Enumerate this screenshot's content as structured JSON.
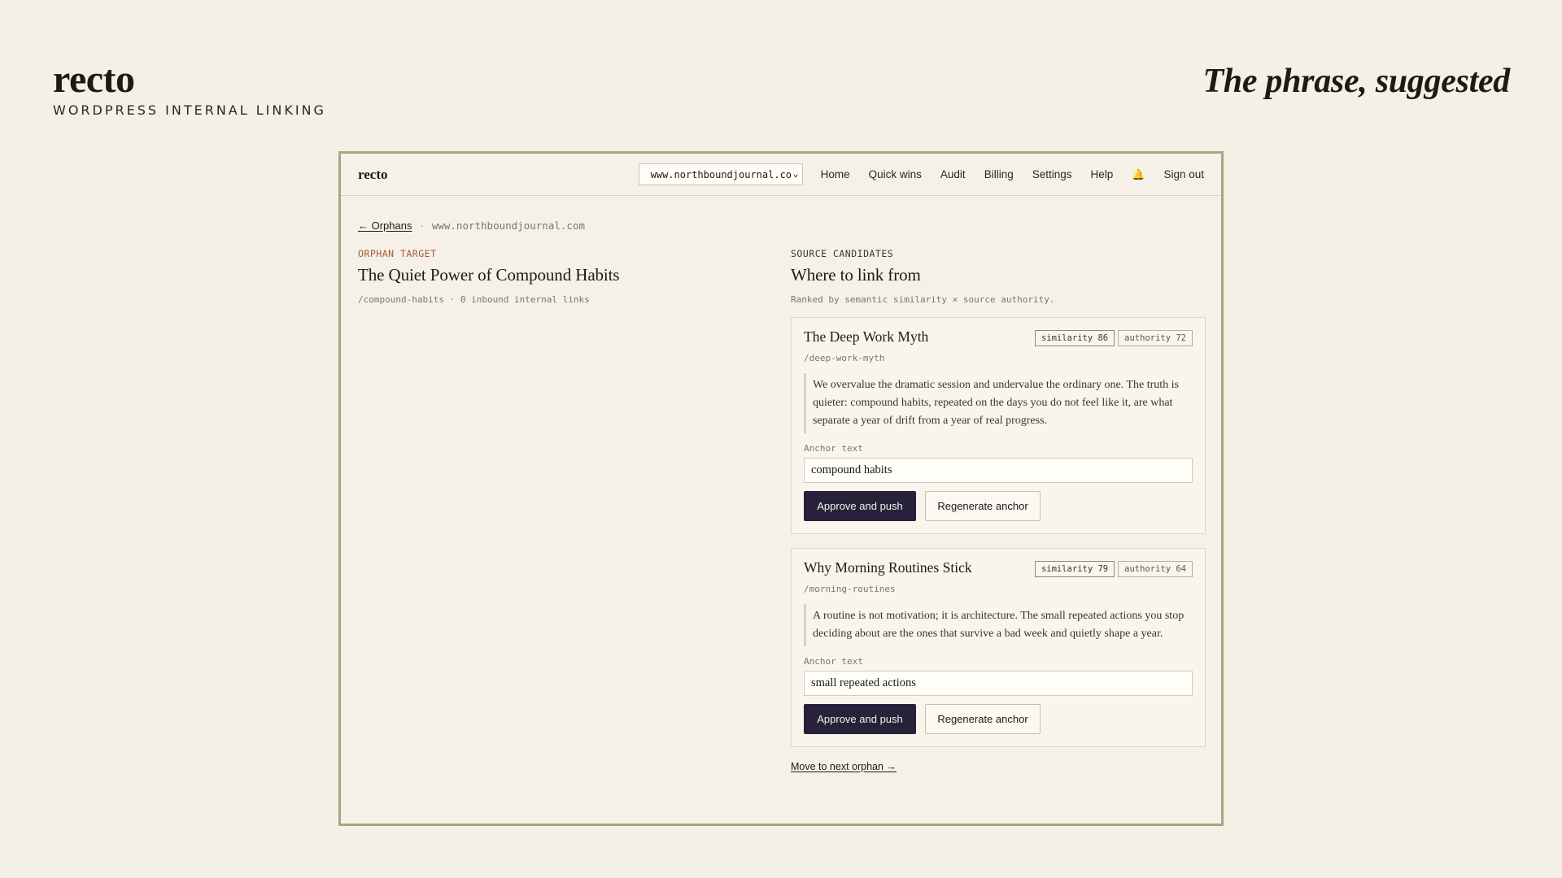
{
  "brand": {
    "name": "recto",
    "subtitle": "WORDPRESS INTERNAL LINKING"
  },
  "tagline": "The phrase, suggested",
  "app": {
    "name": "recto",
    "site_select": "www.northboundjournal.com",
    "nav": [
      "Home",
      "Quick wins",
      "Audit",
      "Billing",
      "Settings",
      "Help"
    ],
    "bell_icon": "bell-icon",
    "sign_out": "Sign out"
  },
  "breadcrumb": {
    "back": "← Orphans",
    "separator": "·",
    "site": "www.northboundjournal.com"
  },
  "orphan": {
    "eyebrow": "ORPHAN TARGET",
    "title": "The Quiet Power of Compound Habits",
    "meta": "/compound-habits · 0 inbound internal links"
  },
  "sources": {
    "eyebrow": "SOURCE CANDIDATES",
    "title": "Where to link from",
    "subtitle": "Ranked by semantic similarity × source authority.",
    "cards": [
      {
        "title": "The Deep Work Myth",
        "similarity": "similarity 86",
        "authority": "authority 72",
        "slug": "/deep-work-myth",
        "excerpt": "We overvalue the dramatic session and undervalue the ordinary one. The truth is quieter: compound habits, repeated on the days you do not feel like it, are what separate a year of drift from a year of real progress.",
        "anchor_label": "Anchor text",
        "anchor_value": "compound habits",
        "approve": "Approve and push",
        "regenerate": "Regenerate anchor"
      },
      {
        "title": "Why Morning Routines Stick",
        "similarity": "similarity 79",
        "authority": "authority 64",
        "slug": "/morning-routines",
        "excerpt": "A routine is not motivation; it is architecture. The small repeated actions you stop deciding about are the ones that survive a bad week and quietly shape a year.",
        "anchor_label": "Anchor text",
        "anchor_value": "small repeated actions",
        "approve": "Approve and push",
        "regenerate": "Regenerate anchor"
      }
    ],
    "next_link": "Move to next orphan →"
  },
  "colors": {
    "primary_button": "#27223a",
    "background": "#f5f0e7",
    "eyebrow_accent": "#a55a3b",
    "frame_border": "#a9a584"
  }
}
